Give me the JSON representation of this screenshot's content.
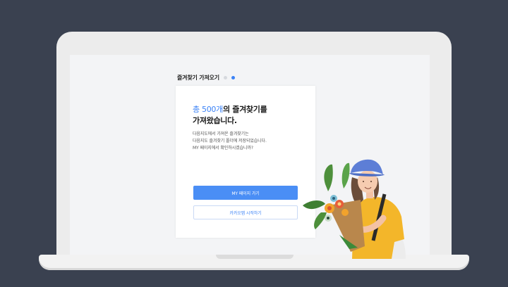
{
  "step": {
    "title": "즐겨찾기 가져오기"
  },
  "card": {
    "headline_accent": "총 500개",
    "headline_rest": "의 즐겨찾기를",
    "headline_line2": "가져왔습니다.",
    "description": [
      "다음지도에서 가져온 즐겨찾기는",
      "다음지도 즐겨찾기 폴더에 저장되었습니다.",
      "MY 페이지에서 확인하시겠습니까?"
    ],
    "primary_button": "MY 페이지 가기",
    "secondary_button": "카카오맵 시작하기"
  },
  "colors": {
    "accent": "#3b82f6",
    "primary_button": "#4a8ef5",
    "background": "#3a4150"
  },
  "illustration": {
    "icon": "person-holding-flowers-icon"
  }
}
